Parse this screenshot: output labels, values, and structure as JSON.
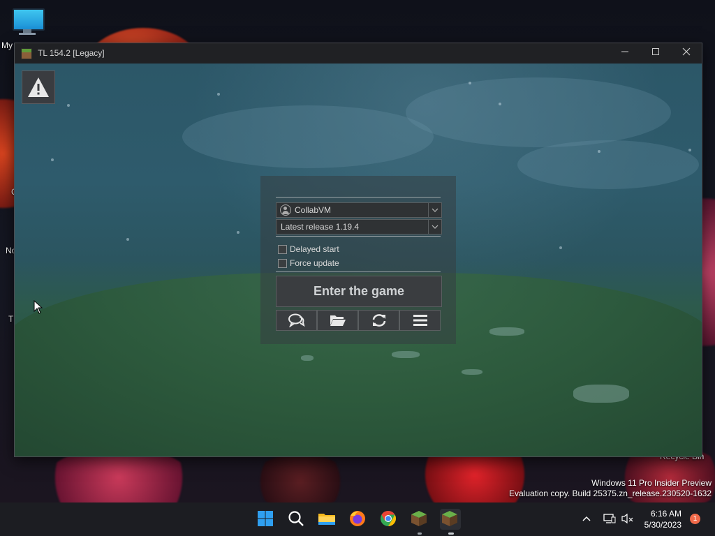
{
  "desktop": {
    "icons": [
      {
        "label": "My"
      },
      {
        "label": "C"
      },
      {
        "label": "No"
      },
      {
        "label": "T"
      },
      {
        "label": "Recycle Bin"
      }
    ],
    "watermark_line1": "Windows 11 Pro Insider Preview",
    "watermark_line2": "Evaluation copy. Build 25375.zn_release.230520-1632"
  },
  "window": {
    "title": "TL 154.2 [Legacy]",
    "minimize_icon": "minimize-icon",
    "maximize_icon": "maximize-icon",
    "close_icon": "close-icon"
  },
  "launcher": {
    "account": "CollabVM",
    "version": "Latest release 1.19.4",
    "delayed_start_label": "Delayed start",
    "force_update_label": "Force update",
    "delayed_start_checked": false,
    "force_update_checked": false,
    "enter_button": "Enter the game",
    "tools": [
      "chat-icon",
      "folder-icon",
      "refresh-icon",
      "menu-icon"
    ]
  },
  "taskbar": {
    "apps": [
      "windows-start-icon",
      "search-icon",
      "file-explorer-icon",
      "firefox-icon",
      "chrome-icon",
      "tlauncher-icon",
      "tlauncher-icon"
    ],
    "time": "6:16 AM",
    "date": "5/30/2023",
    "notification_count": "1"
  },
  "colors": {
    "accent_green": "#5f9b3a",
    "windows_blue": "#2f9ff0",
    "notification": "#f06a4a"
  }
}
